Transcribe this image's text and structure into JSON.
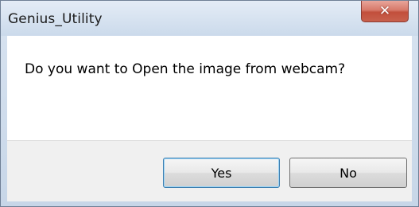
{
  "dialog": {
    "title": "Genius_Utility",
    "close_icon": "close-icon",
    "close_glyph": "✕",
    "message": "Do you want to Open the image from webcam?",
    "buttons": {
      "yes_label": "Yes",
      "no_label": "No"
    }
  }
}
